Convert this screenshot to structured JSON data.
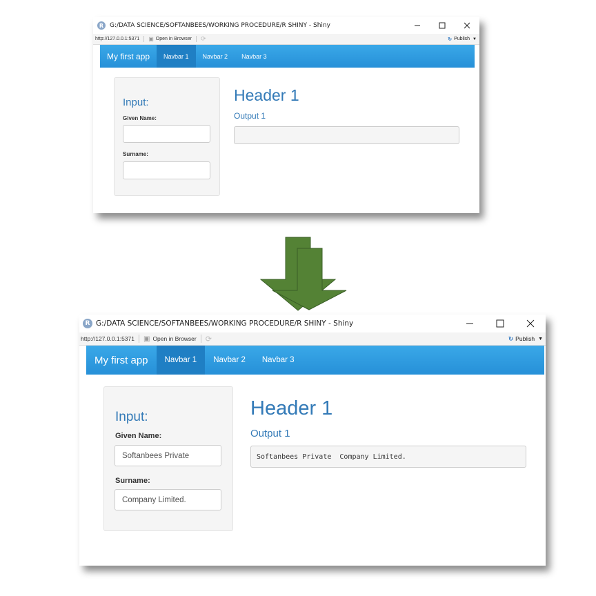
{
  "app": {
    "window_title": "G:/DATA SCIENCE/SOFTANBEES/WORKING PROCEDURE/R SHINY - Shiny",
    "r_logo": "R",
    "url": "http://127.0.0.1:5371",
    "open_in_browser": "Open in Browser",
    "publish": "Publish",
    "brand": "My first app",
    "nav": [
      "Navbar 1",
      "Navbar 2",
      "Navbar 3"
    ],
    "panel_title": "Input:",
    "given_name_label": "Given Name:",
    "surname_label": "Surname:",
    "header": "Header 1",
    "output_label": "Output 1"
  },
  "before": {
    "given_name_value": "",
    "surname_value": "",
    "output_text": ""
  },
  "after": {
    "given_name_value": "Softanbees Private",
    "surname_value": "Company Limited.",
    "output_text": "Softanbees Private  Company Limited."
  },
  "icons": {
    "minimize": "minimize-icon",
    "maximize": "maximize-icon",
    "close": "close-icon",
    "open_browser": "open-browser-icon",
    "refresh": "refresh-icon",
    "publish": "publish-icon",
    "arrow": "down-arrow-icon"
  },
  "colors": {
    "navbar": "#2f9be0",
    "navbar_active": "#1f7fc4",
    "heading": "#337ab7",
    "arrow": "#548235"
  }
}
